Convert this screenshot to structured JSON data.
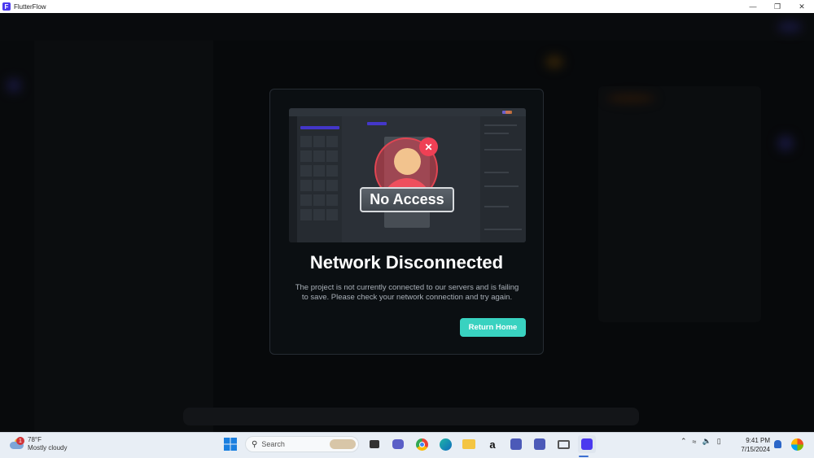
{
  "window": {
    "title": "FlutterFlow",
    "app_icon": "flutterflow-icon",
    "controls": [
      "minimize",
      "restore",
      "close"
    ]
  },
  "modal": {
    "badge_text": "No Access",
    "title": "Network Disconnected",
    "message": "The project is not currently connected to our servers and is failing to save. Please check your network connection and try again.",
    "button_label": "Return Home",
    "accent_color": "#39d2c0",
    "error_color": "#ef4055"
  },
  "taskbar": {
    "weather": {
      "temp": "78°F",
      "condition": "Mostly cloudy",
      "badge": "1"
    },
    "search_placeholder": "Search",
    "clock": {
      "time": "9:41 PM",
      "date": "7/15/2024"
    },
    "pinned": [
      "windows-start-icon",
      "search",
      "task-view-icon",
      "teams-chat-icon",
      "chrome-icon",
      "edge-icon",
      "file-explorer-icon",
      "amazon-icon",
      "app-icon-1",
      "app-icon-2",
      "remote-desktop-icon",
      "flutterflow-icon"
    ]
  }
}
